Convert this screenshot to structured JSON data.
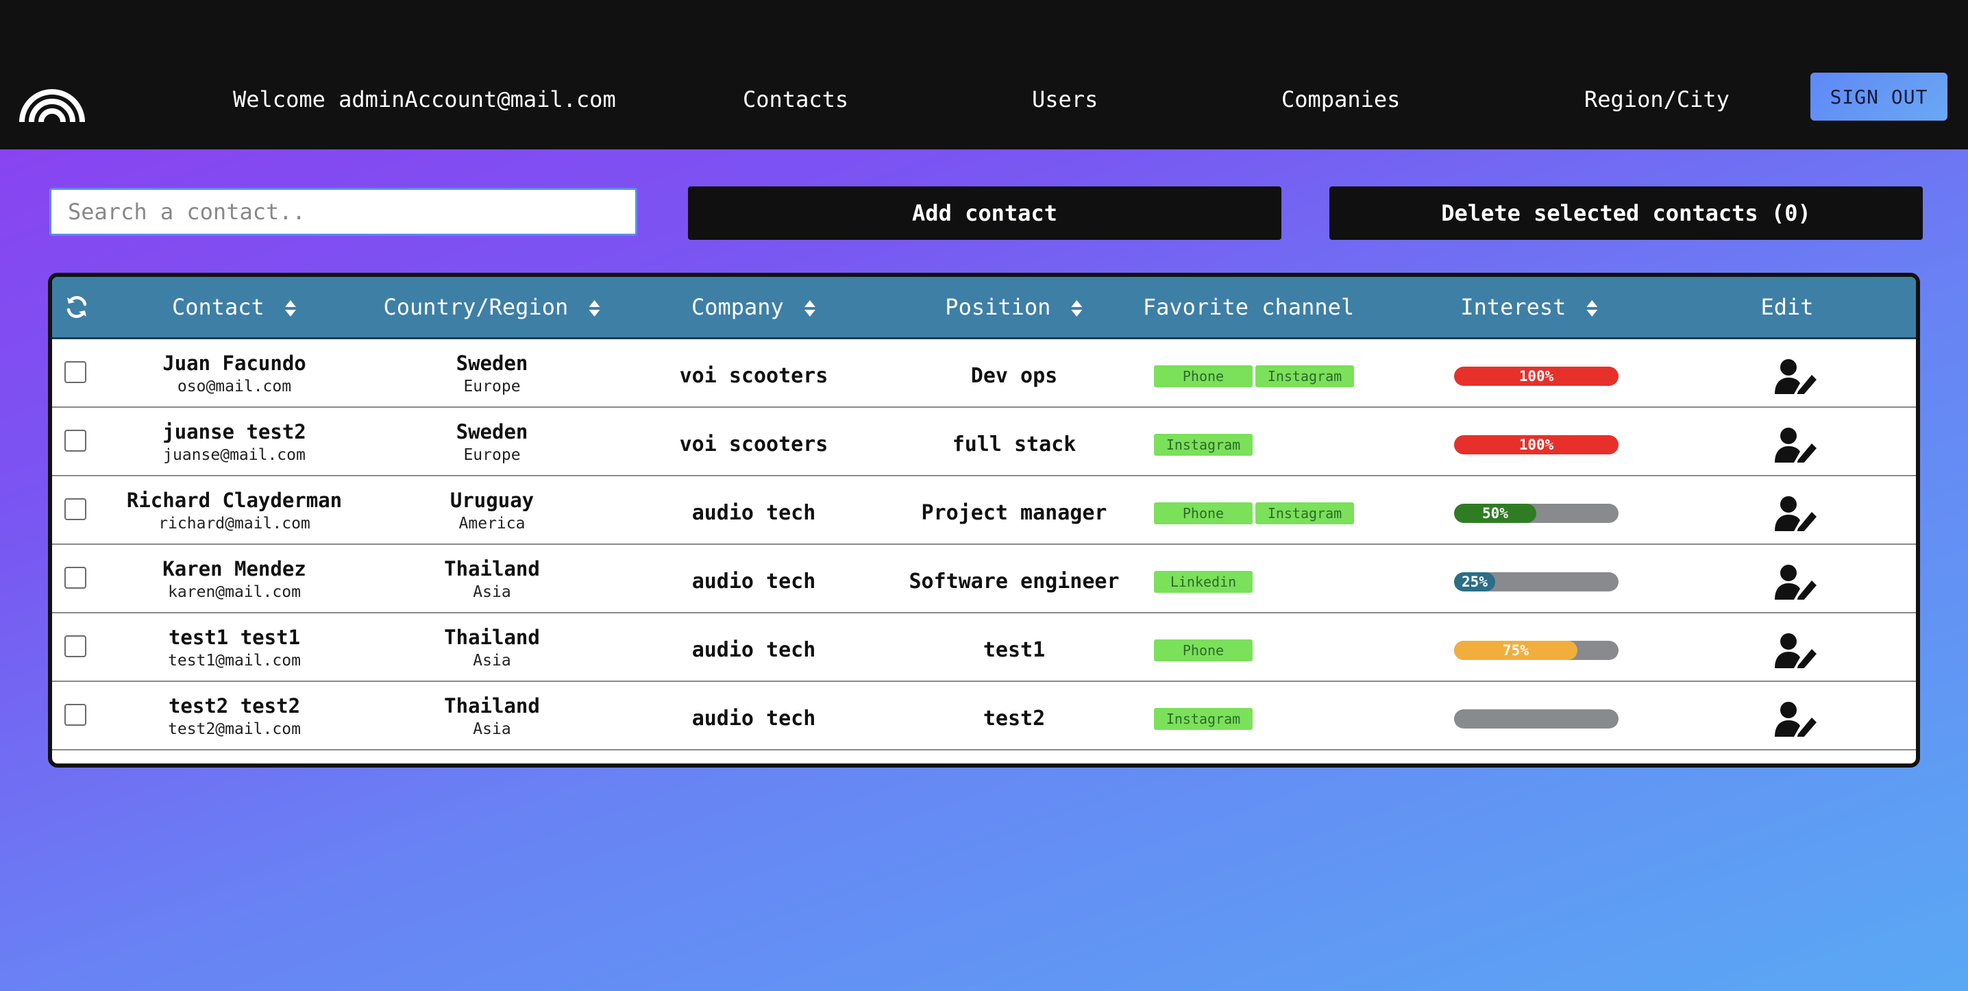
{
  "header": {
    "welcome": "Welcome adminAccount@mail.com",
    "nav": [
      {
        "label": "Contacts"
      },
      {
        "label": "Users"
      },
      {
        "label": "Companies"
      },
      {
        "label": "Region/City"
      }
    ],
    "sign_out": "SIGN OUT"
  },
  "toolbar": {
    "search_placeholder": "Search a contact..",
    "add_contact": "Add contact",
    "delete_selected": "Delete selected contacts (0)"
  },
  "table": {
    "columns": [
      "Contact",
      "Country/Region",
      "Company",
      "Position",
      "Favorite channel",
      "Interest",
      "Edit"
    ],
    "rows": [
      {
        "name": "Juan Facundo",
        "email": "oso@mail.com",
        "country": "Sweden",
        "region": "Europe",
        "company": "voi scooters",
        "position": "Dev ops",
        "channels": [
          "Phone",
          "Instagram"
        ],
        "interest": 100,
        "interest_label": "100%",
        "interest_color": "#e8302a"
      },
      {
        "name": "juanse test2",
        "email": "juanse@mail.com",
        "country": "Sweden",
        "region": "Europe",
        "company": "voi scooters",
        "position": "full stack",
        "channels": [
          "Instagram"
        ],
        "interest": 100,
        "interest_label": "100%",
        "interest_color": "#e8302a"
      },
      {
        "name": "Richard Clayderman",
        "email": "richard@mail.com",
        "country": "Uruguay",
        "region": "America",
        "company": "audio tech",
        "position": "Project manager",
        "channels": [
          "Phone",
          "Instagram"
        ],
        "interest": 50,
        "interest_label": "50%",
        "interest_color": "#2f7d23"
      },
      {
        "name": "Karen Mendez",
        "email": "karen@mail.com",
        "country": "Thailand",
        "region": "Asia",
        "company": "audio tech",
        "position": "Software engineer",
        "channels": [
          "Linkedin"
        ],
        "interest": 25,
        "interest_label": "25%",
        "interest_color": "#2c6e87"
      },
      {
        "name": "test1 test1",
        "email": "test1@mail.com",
        "country": "Thailand",
        "region": "Asia",
        "company": "audio tech",
        "position": "test1",
        "channels": [
          "Phone"
        ],
        "interest": 75,
        "interest_label": "75%",
        "interest_color": "#f2ae3c"
      },
      {
        "name": "test2 test2",
        "email": "test2@mail.com",
        "country": "Thailand",
        "region": "Asia",
        "company": "audio tech",
        "position": "test2",
        "channels": [
          "Instagram"
        ],
        "interest": 0,
        "interest_label": "",
        "interest_color": "#888a8e"
      }
    ]
  },
  "icons": {
    "logo": "rainbow-arch-logo",
    "refresh": "refresh-icon",
    "sort": "sort-icon",
    "edit": "user-edit-icon"
  },
  "colors": {
    "header_bg": "#111111",
    "table_header_bg": "#3e7fa6",
    "tag_bg": "#7be05a",
    "track": "#888a8e"
  }
}
